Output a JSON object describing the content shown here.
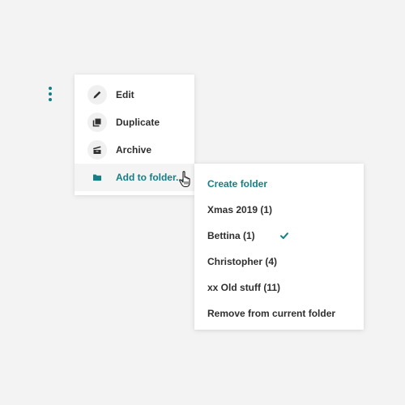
{
  "colors": {
    "accent": "#137f86",
    "text": "#2f2f2f",
    "background": "#f3f3f3",
    "menu_bg": "#ffffff",
    "icon_circle_bg": "#f0f0f0"
  },
  "trigger": {
    "icon": "more-vertical-icon"
  },
  "menu": {
    "items": [
      {
        "label": "Edit",
        "icon": "pencil-icon"
      },
      {
        "label": "Duplicate",
        "icon": "duplicate-icon"
      },
      {
        "label": "Archive",
        "icon": "archive-icon"
      },
      {
        "label": "Add to folder...",
        "icon": "folder-icon",
        "active": true
      }
    ]
  },
  "submenu": {
    "create_label": "Create folder",
    "folders": [
      {
        "label": "Xmas 2019 (1)",
        "selected": false
      },
      {
        "label": "Bettina (1)",
        "selected": true
      },
      {
        "label": "Christopher (4)",
        "selected": false
      },
      {
        "label": "xx Old stuff (11)",
        "selected": false
      }
    ],
    "remove_label": "Remove from current folder"
  },
  "cursor": {
    "icon": "hand-pointer-icon"
  }
}
